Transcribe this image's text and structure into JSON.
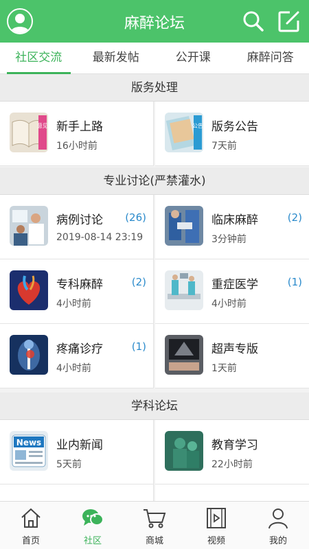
{
  "header": {
    "title": "麻醉论坛"
  },
  "tabs": [
    "社区交流",
    "最新发帖",
    "公开课",
    "麻醉问答"
  ],
  "sections": [
    {
      "title": "版务处理"
    },
    {
      "title": "专业讨论(严禁灌水)"
    },
    {
      "title": "学科论坛"
    }
  ],
  "forums": [
    {
      "name": "新手上路",
      "time": "16小时前",
      "count": ""
    },
    {
      "name": "版务公告",
      "time": "7天前",
      "count": ""
    },
    {
      "name": "病例讨论",
      "time": "2019-08-14 23:19",
      "count": "(26)"
    },
    {
      "name": "临床麻醉",
      "time": "3分钟前",
      "count": "(2)"
    },
    {
      "name": "专科麻醉",
      "time": "4小时前",
      "count": "(2)"
    },
    {
      "name": "重症医学",
      "time": "4小时前",
      "count": "(1)"
    },
    {
      "name": "疼痛诊疗",
      "time": "4小时前",
      "count": "(1)"
    },
    {
      "name": "超声专版",
      "time": "1天前",
      "count": ""
    },
    {
      "name": "业内新闻",
      "time": "5天前",
      "count": ""
    },
    {
      "name": "教育学习",
      "time": "22小时前",
      "count": ""
    }
  ],
  "thumb_text": {
    "notice_left": "意见",
    "notice_right": "公告",
    "news": "News"
  },
  "bottom_nav": [
    "首页",
    "社区",
    "商城",
    "视频",
    "我的"
  ],
  "colors": {
    "brand": "#4cc36a",
    "active": "#3cb35a",
    "count": "#2a8acb"
  }
}
